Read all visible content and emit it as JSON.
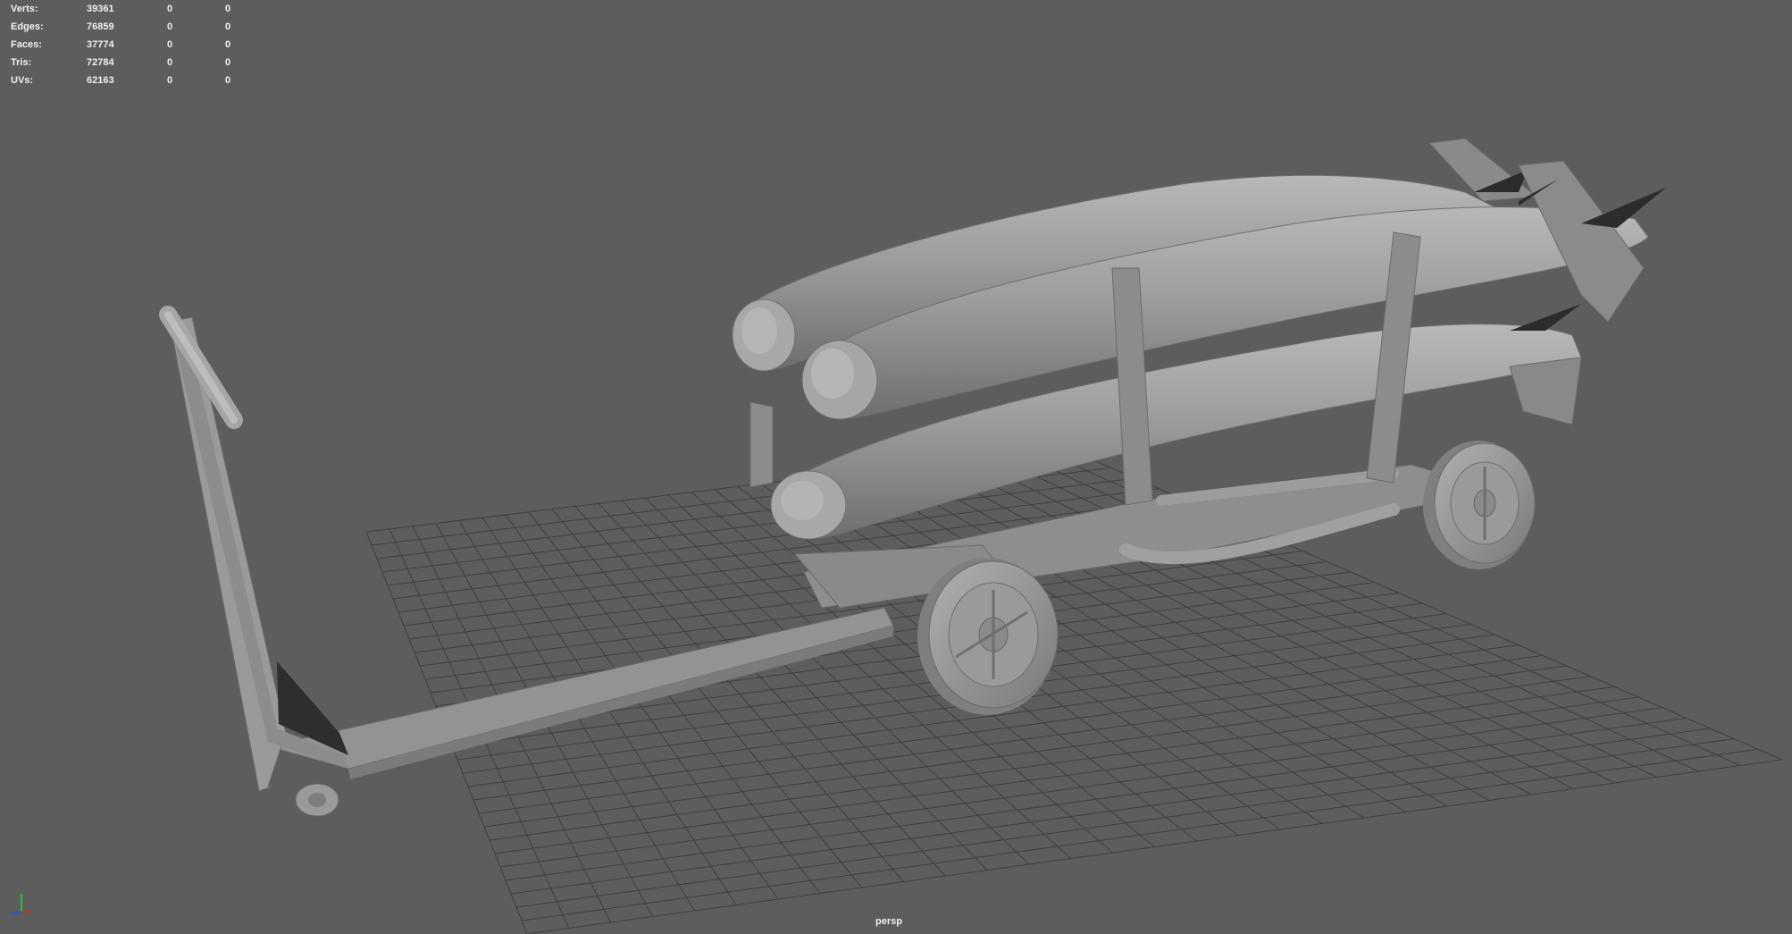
{
  "viewport": {
    "camera": "persp",
    "background_color": "#5d5d5d",
    "grid_color": "#3f3f3f",
    "model_color": "#9a9a9a"
  },
  "heads_up_display": {
    "rows": [
      {
        "label": "Verts:",
        "values": [
          "39361",
          "0",
          "0"
        ]
      },
      {
        "label": "Edges:",
        "values": [
          "76859",
          "0",
          "0"
        ]
      },
      {
        "label": "Faces:",
        "values": [
          "37774",
          "0",
          "0"
        ]
      },
      {
        "label": "Tris:",
        "values": [
          "72784",
          "0",
          "0"
        ]
      },
      {
        "label": "UVs:",
        "values": [
          "62163",
          "0",
          "0"
        ]
      }
    ]
  },
  "axis_gizmo": {
    "icon": "axis-gizmo-icon",
    "x_color": "#d03030",
    "y_color": "#30c030",
    "z_color": "#3050e0"
  }
}
